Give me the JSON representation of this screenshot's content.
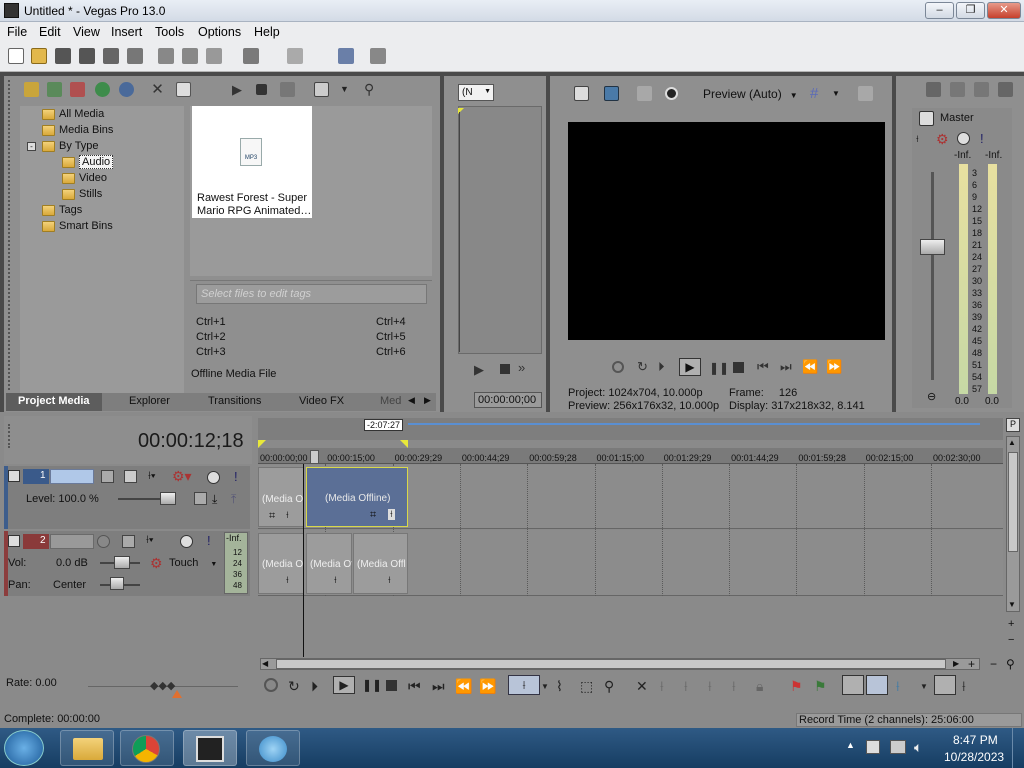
{
  "window": {
    "title": "Untitled * - Vegas Pro 13.0",
    "min_label": "–",
    "max_label": "❐",
    "close_label": "✕"
  },
  "menu": [
    "File",
    "Edit",
    "View",
    "Insert",
    "Tools",
    "Options",
    "Help"
  ],
  "media": {
    "tree": {
      "all_media": "All Media",
      "media_bins": "Media Bins",
      "by_type": "By Type",
      "audio": "Audio",
      "video": "Video",
      "stills": "Stills",
      "tags": "Tags",
      "smart_bins": "Smart Bins"
    },
    "file": {
      "name_line1": "Rawest Forest - Super",
      "name_line2": "Mario RPG Animated…",
      "icon_label": "MP3"
    },
    "tag_placeholder": "Select files to edit tags",
    "shortcuts": {
      "c1": "Ctrl+1",
      "c2": "Ctrl+2",
      "c3": "Ctrl+3",
      "c4": "Ctrl+4",
      "c5": "Ctrl+5",
      "c6": "Ctrl+6"
    },
    "status": "Offline Media File",
    "tabs": {
      "project_media": "Project Media",
      "explorer": "Explorer",
      "transitions": "Transitions",
      "video_fx": "Video FX",
      "media_gen": "Med"
    }
  },
  "trimmer": {
    "dropdown": "(N",
    "timecode": "00:00:00;00"
  },
  "preview": {
    "mode": "Preview (Auto)",
    "project_label": "Project:",
    "project_value": "1024x704, 10.000p",
    "preview_label": "Preview:",
    "preview_value": "256x176x32, 10.000p",
    "frame_label": "Frame:",
    "frame_value": "126",
    "display_label": "Display:",
    "display_value": "317x218x32, 8.141"
  },
  "master": {
    "label": "Master",
    "inf_l": "-Inf.",
    "inf_r": "-Inf.",
    "scale": [
      "3",
      "6",
      "9",
      "12",
      "15",
      "18",
      "21",
      "24",
      "27",
      "30",
      "33",
      "36",
      "39",
      "42",
      "45",
      "48",
      "51",
      "54",
      "57"
    ],
    "val_l": "0.0",
    "val_r": "0.0"
  },
  "timeline": {
    "timecode": "00:00:12;18",
    "loop_label": "-2:07:27",
    "ruler": [
      "00:00:00;00",
      "00:00:15;00",
      "00:00:29;29",
      "00:00:44;29",
      "00:00:59;28",
      "00:01:15;00",
      "00:01:29;29",
      "00:01:44;29",
      "00:01:59;28",
      "00:02:15;00",
      "00:02:30;00"
    ],
    "video_track": {
      "number": "1",
      "level": "Level: 100.0 %"
    },
    "audio_track": {
      "number": "2",
      "vol_label": "Vol:",
      "vol_value": "0.0 dB",
      "pan_label": "Pan:",
      "pan_value": "Center",
      "automation": "Touch",
      "meter_inf": "-Inf.",
      "meter_scale": [
        "12",
        "24",
        "36",
        "48"
      ]
    },
    "clip_offline": "(Media Offline)",
    "clip_offline_short": "(Media Of",
    "clip_offline_short2": "(Media Offl",
    "rate": "Rate: 0.00",
    "complete": "Complete: 00:00:00",
    "record_time": "Record Time (2 channels): 25:06:00"
  },
  "taskbar": {
    "time": "8:47 PM",
    "date": "10/28/2023"
  }
}
